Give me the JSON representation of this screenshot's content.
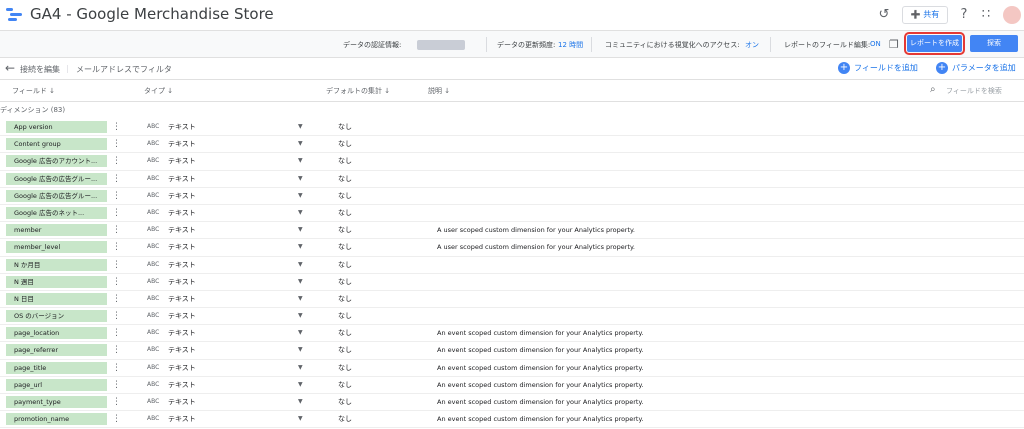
{
  "app": {
    "title": "GA4 - Google Merchandise Store",
    "share_label": "共有"
  },
  "icons": {
    "history": "history-icon",
    "help": "help-icon",
    "apps": "apps-grid-icon",
    "copy": "copy-icon",
    "back": "arrow-back-icon",
    "search": "search-icon",
    "sort": "sort-arrow-icon"
  },
  "colors": {
    "accent": "#4285f4",
    "link": "#1a73e8",
    "pill": "#c8e6c9",
    "highlight": "#e53935"
  },
  "subbar": {
    "credentials_label": "データの認証情報:",
    "freshness_label": "データの更新頻度:",
    "freshness_value": "12 時間",
    "community_label": "コミュニティにおける視覚化へのアクセス:",
    "community_value": "オン",
    "field_edit_label": "レポートのフィールド編集:",
    "field_edit_value": "ON",
    "create_report": "レポートを作成",
    "explore": "探索"
  },
  "toolbar": {
    "edit_connection": "接続を編集",
    "filter_by_email": "メールアドレスでフィルタ",
    "add_field": "フィールドを追加",
    "add_parameter": "パラメータを追加"
  },
  "columns": {
    "field": "フィールド",
    "type": "タイプ",
    "default_agg": "デフォルトの集計",
    "description": "説明",
    "search_placeholder": "フィールドを検索"
  },
  "section": {
    "label": "ディメンション (83)"
  },
  "rows": [
    {
      "name": "App version",
      "abc": "ABC",
      "type": "テキスト",
      "agg": "なし",
      "desc": ""
    },
    {
      "name": "Content group",
      "abc": "ABC",
      "type": "テキスト",
      "agg": "なし",
      "desc": ""
    },
    {
      "name": "Google 広告のアカウント...",
      "abc": "ABC",
      "type": "テキスト",
      "agg": "なし",
      "desc": ""
    },
    {
      "name": "Google 広告の広告グルー...",
      "abc": "ABC",
      "type": "テキスト",
      "agg": "なし",
      "desc": ""
    },
    {
      "name": "Google 広告の広告グルー...",
      "abc": "ABC",
      "type": "テキスト",
      "agg": "なし",
      "desc": ""
    },
    {
      "name": "Google 広告のネット...",
      "abc": "ABC",
      "type": "テキスト",
      "agg": "なし",
      "desc": ""
    },
    {
      "name": "member",
      "abc": "ABC",
      "type": "テキスト",
      "agg": "なし",
      "desc": "A user scoped custom dimension for your Analytics property."
    },
    {
      "name": "member_level",
      "abc": "ABC",
      "type": "テキスト",
      "agg": "なし",
      "desc": "A user scoped custom dimension for your Analytics property."
    },
    {
      "name": "N か月目",
      "abc": "ABC",
      "type": "テキスト",
      "agg": "なし",
      "desc": ""
    },
    {
      "name": "N 週目",
      "abc": "ABC",
      "type": "テキスト",
      "agg": "なし",
      "desc": ""
    },
    {
      "name": "N 日目",
      "abc": "ABC",
      "type": "テキスト",
      "agg": "なし",
      "desc": ""
    },
    {
      "name": "OS のバージョン",
      "abc": "ABC",
      "type": "テキスト",
      "agg": "なし",
      "desc": ""
    },
    {
      "name": "page_location",
      "abc": "ABC",
      "type": "テキスト",
      "agg": "なし",
      "desc": "An event scoped custom dimension for your Analytics property."
    },
    {
      "name": "page_referrer",
      "abc": "ABC",
      "type": "テキスト",
      "agg": "なし",
      "desc": "An event scoped custom dimension for your Analytics property."
    },
    {
      "name": "page_title",
      "abc": "ABC",
      "type": "テキスト",
      "agg": "なし",
      "desc": "An event scoped custom dimension for your Analytics property."
    },
    {
      "name": "page_url",
      "abc": "ABC",
      "type": "テキスト",
      "agg": "なし",
      "desc": "An event scoped custom dimension for your Analytics property."
    },
    {
      "name": "payment_type",
      "abc": "ABC",
      "type": "テキスト",
      "agg": "なし",
      "desc": "An event scoped custom dimension for your Analytics property."
    },
    {
      "name": "promotion_name",
      "abc": "ABC",
      "type": "テキスト",
      "agg": "なし",
      "desc": "An event scoped custom dimension for your Analytics property."
    }
  ]
}
